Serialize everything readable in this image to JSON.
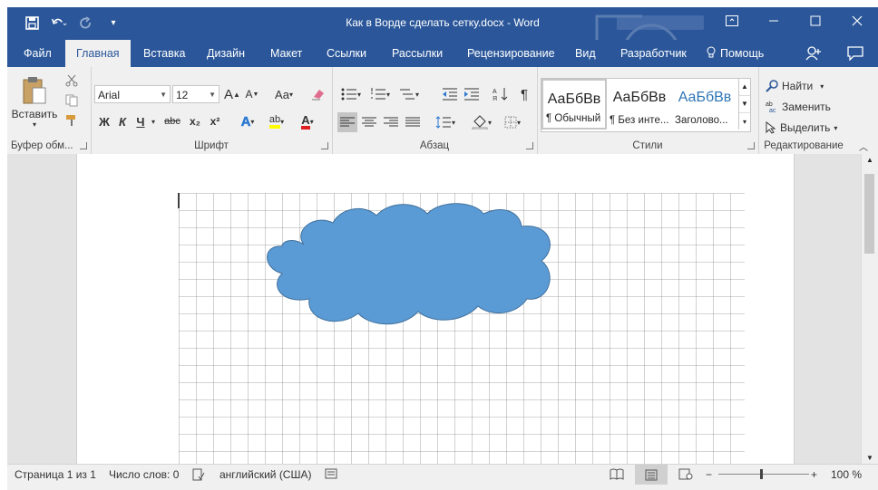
{
  "window": {
    "title": "Как в Ворде сделать сетку.docx - Word",
    "accent": "#2b579a"
  },
  "qat": [
    "save-icon",
    "undo-icon",
    "redo-icon",
    "customize-qat-icon"
  ],
  "tabs": [
    {
      "label": "Файл"
    },
    {
      "label": "Главная"
    },
    {
      "label": "Вставка"
    },
    {
      "label": "Дизайн"
    },
    {
      "label": "Макет"
    },
    {
      "label": "Ссылки"
    },
    {
      "label": "Рассылки"
    },
    {
      "label": "Рецензирование"
    },
    {
      "label": "Вид"
    },
    {
      "label": "Разработчик"
    }
  ],
  "tell_me": "Помощь",
  "ribbon": {
    "clipboard": {
      "paste": "Вставить",
      "label": "Буфер обм..."
    },
    "font": {
      "name": "Arial",
      "size": "12",
      "label": "Шрифт",
      "bold": "Ж",
      "italic": "К",
      "underline": "Ч",
      "strike": "abc",
      "sub": "x₂",
      "sup": "x²",
      "grow": "A",
      "shrink": "A",
      "case": "Aa"
    },
    "paragraph": {
      "label": "Абзац"
    },
    "styles": {
      "label": "Стили",
      "items": [
        {
          "sample": "АаБбВв",
          "name": "¶ Обычный"
        },
        {
          "sample": "АаБбВв",
          "name": "¶ Без инте..."
        },
        {
          "sample": "АаБбВв",
          "name": "Заголово..."
        }
      ]
    },
    "editing": {
      "find": "Найти",
      "replace": "Заменить",
      "select": "Выделить",
      "label": "Редактирование"
    }
  },
  "document": {
    "shape": "cloud",
    "shape_fill": "#5b9bd5",
    "shape_stroke": "#41719c"
  },
  "status": {
    "page": "Страница 1 из 1",
    "words": "Число слов: 0",
    "language": "английский (США)",
    "zoom": "100 %"
  }
}
